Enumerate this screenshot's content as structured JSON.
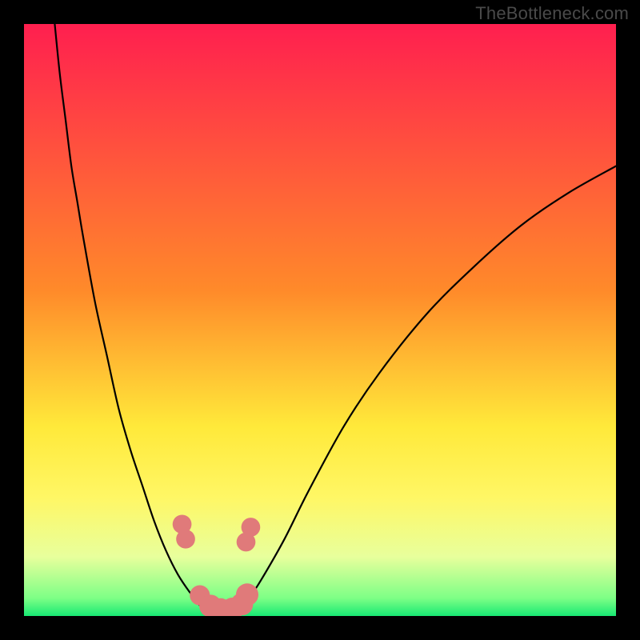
{
  "watermark": "TheBottleneck.com",
  "chart_data": {
    "type": "line",
    "title": "",
    "xlabel": "",
    "ylabel": "",
    "xlim": [
      0,
      100
    ],
    "ylim": [
      0,
      100
    ],
    "background_gradient": {
      "stops": [
        {
          "y": 0,
          "color": "#ff1f4f"
        },
        {
          "y": 45,
          "color": "#ff8a2a"
        },
        {
          "y": 68,
          "color": "#ffe93a"
        },
        {
          "y": 80,
          "color": "#fff765"
        },
        {
          "y": 90,
          "color": "#e8ff9c"
        },
        {
          "y": 97,
          "color": "#7dff86"
        },
        {
          "y": 100,
          "color": "#18e873"
        }
      ]
    },
    "series": [
      {
        "name": "curve-left",
        "stroke": "#000000",
        "stroke_width": 2.2,
        "x": [
          5,
          6,
          7,
          8,
          9,
          10,
          12,
          14,
          16,
          18,
          20,
          22,
          24,
          26,
          28,
          30,
          32
        ],
        "y": [
          102,
          92,
          84,
          76,
          70,
          64,
          53,
          44,
          35,
          28,
          22,
          16,
          11,
          7,
          4,
          1.5,
          0.5
        ]
      },
      {
        "name": "curve-right",
        "stroke": "#000000",
        "stroke_width": 2.2,
        "x": [
          36,
          38,
          40,
          44,
          48,
          54,
          60,
          68,
          76,
          84,
          92,
          100
        ],
        "y": [
          0.8,
          3,
          6,
          13,
          21,
          32,
          41,
          51,
          59,
          66,
          71.5,
          76
        ]
      }
    ],
    "points": [
      {
        "name": "p1",
        "x": 26.7,
        "y": 15.5,
        "r": 1.6,
        "color": "#e07a7a"
      },
      {
        "name": "p2",
        "x": 27.3,
        "y": 13.0,
        "r": 1.6,
        "color": "#e07a7a"
      },
      {
        "name": "p3",
        "x": 29.7,
        "y": 3.5,
        "r": 1.7,
        "color": "#e07a7a"
      },
      {
        "name": "p4",
        "x": 31.5,
        "y": 1.7,
        "r": 1.9,
        "color": "#e07a7a"
      },
      {
        "name": "p5",
        "x": 33.2,
        "y": 1.1,
        "r": 1.9,
        "color": "#e07a7a"
      },
      {
        "name": "p6",
        "x": 35.2,
        "y": 1.2,
        "r": 1.9,
        "color": "#e07a7a"
      },
      {
        "name": "p7",
        "x": 36.8,
        "y": 2.0,
        "r": 1.9,
        "color": "#e07a7a"
      },
      {
        "name": "p8",
        "x": 37.7,
        "y": 3.6,
        "r": 1.9,
        "color": "#e07a7a"
      },
      {
        "name": "p9",
        "x": 37.5,
        "y": 12.5,
        "r": 1.6,
        "color": "#e07a7a"
      },
      {
        "name": "p10",
        "x": 38.3,
        "y": 15.0,
        "r": 1.6,
        "color": "#e07a7a"
      }
    ]
  }
}
